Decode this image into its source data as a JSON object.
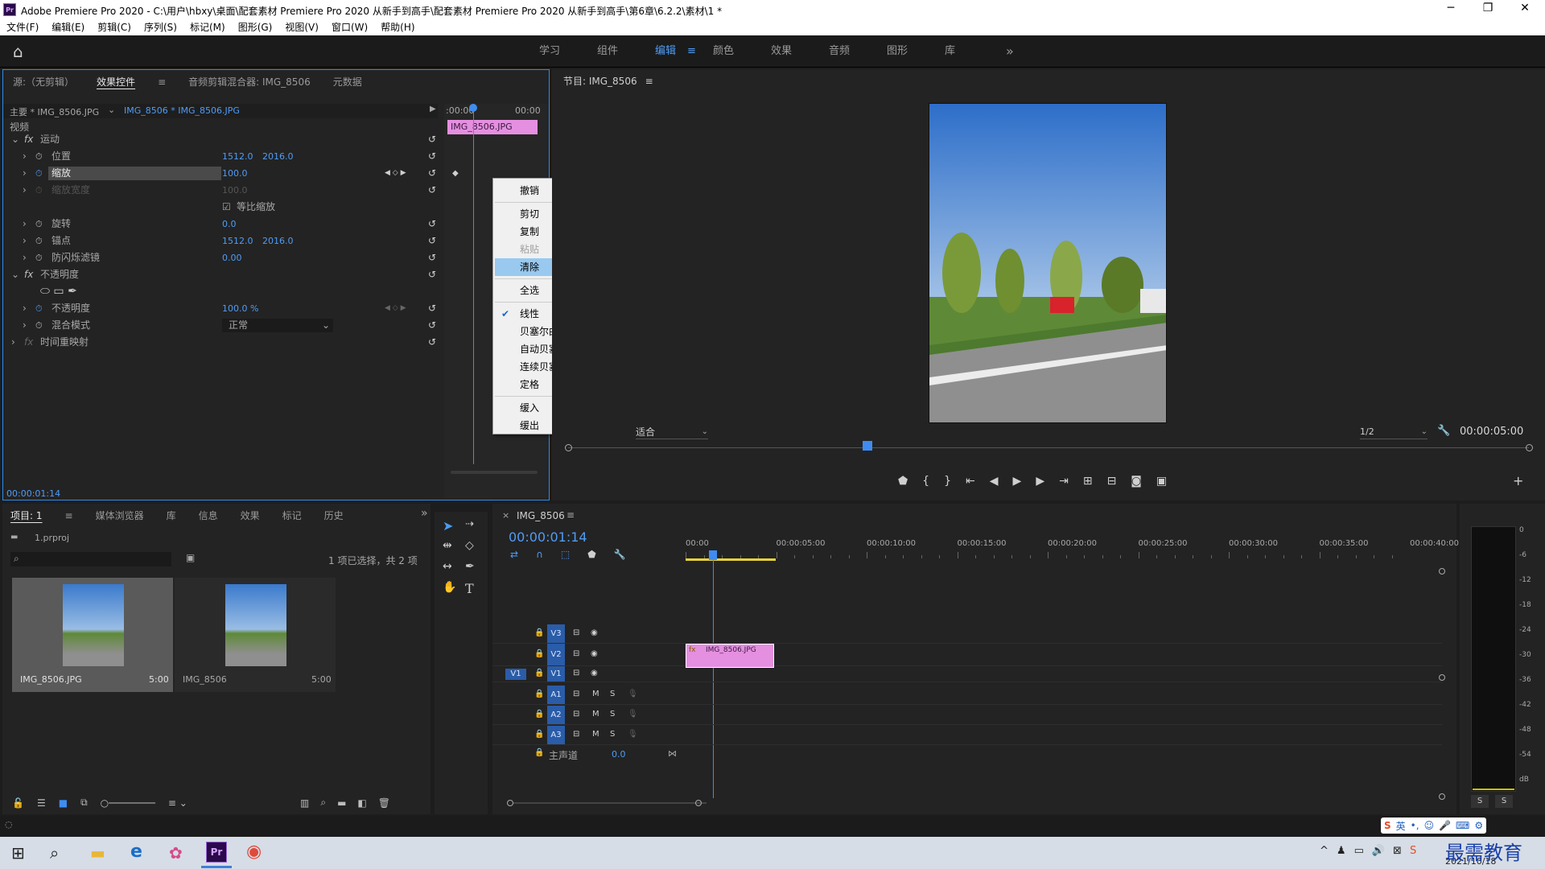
{
  "window": {
    "title": "Adobe Premiere Pro 2020 - C:\\用户\\hbxy\\桌面\\配套素材 Premiere Pro 2020 从新手到高手\\配套素材 Premiere Pro 2020 从新手到高手\\第6章\\6.2.2\\素材\\1 *",
    "logo": "Pr"
  },
  "menu": [
    "文件(F)",
    "编辑(E)",
    "剪辑(C)",
    "序列(S)",
    "标记(M)",
    "图形(G)",
    "视图(V)",
    "窗口(W)",
    "帮助(H)"
  ],
  "workspaces": [
    "学习",
    "组件",
    "编辑",
    "颜色",
    "效果",
    "音频",
    "图形",
    "库"
  ],
  "active_workspace": "编辑",
  "source_panel": {
    "tabs": [
      "源:（无剪辑）",
      "效果控件",
      "音频剪辑混合器: IMG_8506",
      "元数据"
    ],
    "active_tab": "效果控件",
    "master": "主要 * IMG_8506.JPG",
    "clip": "IMG_8506 * IMG_8506.JPG",
    "video_label": "视频",
    "clip_bar": "IMG_8506.JPG",
    "time_start": ":00:00",
    "time_end": "00:00",
    "timecode": "00:00:01:14"
  },
  "effects": [
    {
      "label": "运动",
      "fx": true,
      "expanded": true
    },
    {
      "label": "位置",
      "v1": "1512.0",
      "v2": "2016.0"
    },
    {
      "label": "缩放",
      "v1": "100.0",
      "selected": true,
      "keys": true
    },
    {
      "label": "缩放宽度",
      "v1": "100.0",
      "disabled": true
    },
    {
      "label": "",
      "checkbox": "等比缩放"
    },
    {
      "label": "旋转",
      "v1": "0.0"
    },
    {
      "label": "锚点",
      "v1": "1512.0",
      "v2": "2016.0"
    },
    {
      "label": "防闪烁滤镜",
      "v1": "0.00"
    },
    {
      "label": "不透明度",
      "fx": true,
      "expanded": true
    },
    {
      "label": "",
      "shapes": true
    },
    {
      "label": "不透明度",
      "v1": "100.0 %",
      "keys": true
    },
    {
      "label": "混合模式",
      "dropdown": "正常"
    },
    {
      "label": "时间重映射",
      "fx": true,
      "expanded": false
    }
  ],
  "context_menu": [
    {
      "label": "撤销"
    },
    {
      "sep": true
    },
    {
      "label": "剪切"
    },
    {
      "label": "复制"
    },
    {
      "label": "粘贴",
      "disabled": true
    },
    {
      "label": "清除",
      "highlight": true
    },
    {
      "sep": true
    },
    {
      "label": "全选"
    },
    {
      "sep": true
    },
    {
      "label": "线性",
      "checked": true
    },
    {
      "label": "贝塞尔曲线"
    },
    {
      "label": "自动贝塞尔曲线"
    },
    {
      "label": "连续贝塞尔曲线"
    },
    {
      "label": "定格"
    },
    {
      "sep": true
    },
    {
      "label": "缓入"
    },
    {
      "label": "缓出"
    }
  ],
  "program": {
    "title": "节目: IMG_8506",
    "fit": "适合",
    "quality": "1/2",
    "duration": "00:00:05:00"
  },
  "project": {
    "tabs": [
      "项目: 1",
      "媒体浏览器",
      "库",
      "信息",
      "效果",
      "标记",
      "历史"
    ],
    "file": "1.prproj",
    "selection": "1 项已选择，共 2 项",
    "items": [
      {
        "name": "IMG_8506.JPG",
        "dur": "5:00"
      },
      {
        "name": "IMG_8506",
        "dur": "5:00"
      }
    ]
  },
  "timeline": {
    "title": "IMG_8506",
    "timecode": "00:00:01:14",
    "ruler": [
      "00:00",
      "00:00:05:00",
      "00:00:10:00",
      "00:00:15:00",
      "00:00:20:00",
      "00:00:25:00",
      "00:00:30:00",
      "00:00:35:00",
      "00:00:40:00"
    ],
    "clip": "IMG_8506.JPG",
    "video_tracks": [
      "V3",
      "V2",
      "V1"
    ],
    "audio_tracks": [
      "A1",
      "A2",
      "A3"
    ],
    "master": "主声道",
    "master_val": "0.0",
    "source_v": "V1"
  },
  "meter": {
    "labels": [
      "0",
      "-6",
      "-12",
      "-18",
      "-24",
      "-30",
      "-36",
      "-42",
      "-48",
      "-54",
      "dB"
    ],
    "solo": [
      "S",
      "S"
    ]
  },
  "taskbar": {
    "date": "2021/10/18",
    "ime": "英",
    "watermark": "最需教育"
  }
}
